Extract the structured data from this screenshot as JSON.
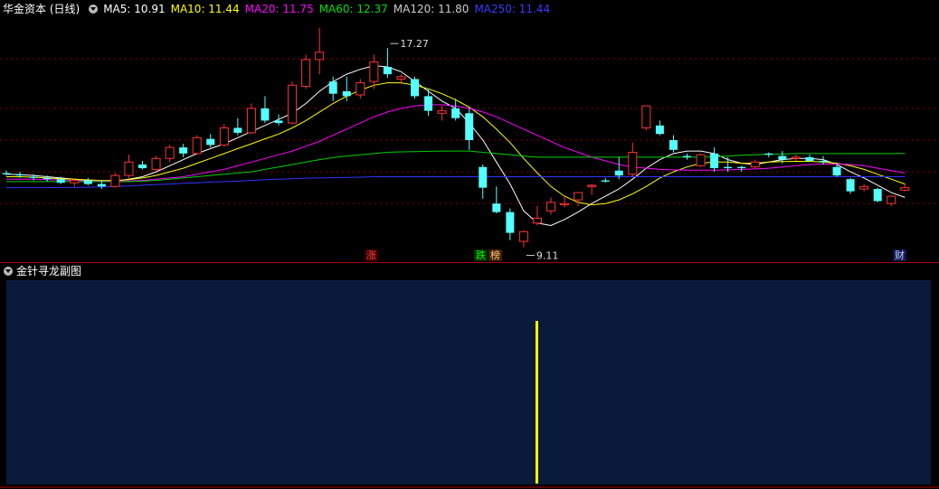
{
  "header": {
    "stock_name": "华金资本 (日线)",
    "ma": [
      {
        "label": "MA5: 10.91",
        "color": "#ffffff"
      },
      {
        "label": "MA10: 11.44",
        "color": "#ffff00"
      },
      {
        "label": "MA20: 11.75",
        "color": "#ff00ff"
      },
      {
        "label": "MA60: 12.37",
        "color": "#00e000"
      },
      {
        "label": "MA120: 11.80",
        "color": "#cccccc"
      },
      {
        "label": "MA250: 11.44",
        "color": "#2222ff"
      }
    ]
  },
  "sub_header": {
    "title": "金针寻龙副图"
  },
  "tags": {
    "zhang": "涨",
    "die": "跌",
    "bang": "榜",
    "cai": "财"
  },
  "colors": {
    "up": "#ff3232",
    "down": "#54ffff",
    "subpanel_bg": "#0a1a3a",
    "grid": "#8b0000",
    "signal": "#ffff00"
  },
  "chart_data": [
    {
      "type": "candlestick",
      "title": "华金资本 (日线)",
      "ylim": [
        8.5,
        18.5
      ],
      "annotations": [
        {
          "label": "17.27",
          "value": 17.27,
          "candle_index": 28
        },
        {
          "label": "9.11",
          "value": 9.11,
          "candle_index": 38
        }
      ],
      "candles": [
        [
          12.15,
          12.25,
          12.05,
          12.1
        ],
        [
          12.1,
          12.2,
          11.95,
          12.05
        ],
        [
          12.0,
          12.1,
          11.85,
          11.95
        ],
        [
          11.95,
          12.05,
          11.8,
          11.9
        ],
        [
          11.9,
          12.0,
          11.7,
          11.75
        ],
        [
          11.75,
          11.9,
          11.6,
          11.85
        ],
        [
          11.85,
          11.95,
          11.65,
          11.7
        ],
        [
          11.7,
          11.85,
          11.5,
          11.6
        ],
        [
          11.6,
          12.15,
          11.55,
          12.05
        ],
        [
          12.05,
          12.9,
          11.95,
          12.6
        ],
        [
          12.5,
          12.65,
          12.3,
          12.35
        ],
        [
          12.3,
          12.85,
          12.2,
          12.75
        ],
        [
          12.75,
          13.3,
          12.6,
          13.2
        ],
        [
          13.2,
          13.35,
          12.8,
          12.95
        ],
        [
          12.95,
          13.7,
          12.9,
          13.6
        ],
        [
          13.55,
          13.75,
          13.2,
          13.3
        ],
        [
          13.3,
          14.15,
          13.25,
          14.0
        ],
        [
          14.0,
          14.4,
          13.7,
          13.8
        ],
        [
          13.8,
          15.0,
          13.75,
          14.8
        ],
        [
          14.8,
          15.3,
          14.2,
          14.3
        ],
        [
          14.3,
          14.55,
          14.1,
          14.2
        ],
        [
          14.2,
          15.9,
          14.15,
          15.75
        ],
        [
          15.7,
          17.0,
          15.6,
          16.8
        ],
        [
          16.8,
          18.1,
          16.2,
          17.1
        ],
        [
          15.9,
          16.1,
          15.1,
          15.4
        ],
        [
          15.5,
          16.1,
          15.1,
          15.3
        ],
        [
          15.35,
          16.0,
          15.2,
          15.85
        ],
        [
          15.9,
          17.0,
          15.6,
          16.7
        ],
        [
          16.5,
          17.27,
          16.05,
          16.2
        ],
        [
          16.0,
          16.2,
          15.8,
          16.1
        ],
        [
          16.0,
          16.1,
          15.2,
          15.3
        ],
        [
          15.3,
          15.6,
          14.5,
          14.7
        ],
        [
          14.6,
          14.9,
          14.3,
          14.7
        ],
        [
          14.8,
          15.2,
          14.3,
          14.4
        ],
        [
          14.6,
          14.8,
          13.1,
          13.5
        ],
        [
          12.4,
          12.5,
          11.1,
          11.55
        ],
        [
          10.9,
          11.6,
          10.5,
          10.55
        ],
        [
          10.55,
          10.7,
          9.4,
          9.7
        ],
        [
          9.35,
          9.8,
          9.11,
          9.75
        ],
        [
          10.1,
          10.8,
          10.0,
          10.3
        ],
        [
          10.6,
          11.15,
          10.45,
          10.95
        ],
        [
          10.85,
          11.2,
          10.75,
          10.9
        ],
        [
          11.05,
          11.35,
          10.8,
          11.35
        ],
        [
          11.6,
          11.7,
          11.25,
          11.65
        ],
        [
          11.85,
          11.95,
          11.75,
          11.8
        ],
        [
          12.25,
          12.8,
          11.9,
          12.05
        ],
        [
          12.1,
          13.4,
          12.0,
          13.0
        ],
        [
          14.0,
          14.8,
          13.9,
          14.9
        ],
        [
          14.1,
          14.3,
          13.7,
          13.75
        ],
        [
          13.5,
          13.7,
          13.0,
          13.1
        ],
        [
          12.85,
          12.95,
          12.7,
          12.8
        ],
        [
          12.45,
          12.95,
          12.4,
          12.9
        ],
        [
          12.95,
          13.2,
          12.2,
          12.35
        ],
        [
          12.4,
          12.8,
          12.2,
          12.35
        ],
        [
          12.4,
          12.45,
          12.2,
          12.35
        ],
        [
          12.4,
          12.7,
          12.35,
          12.6
        ],
        [
          12.95,
          13.0,
          12.8,
          12.9
        ],
        [
          12.85,
          13.05,
          12.55,
          12.7
        ],
        [
          12.75,
          12.9,
          12.65,
          12.8
        ],
        [
          12.8,
          12.9,
          12.6,
          12.65
        ],
        [
          12.65,
          12.85,
          12.5,
          12.6
        ],
        [
          12.4,
          12.5,
          12.0,
          12.05
        ],
        [
          11.9,
          11.95,
          11.3,
          11.4
        ],
        [
          11.5,
          11.7,
          11.4,
          11.6
        ],
        [
          11.5,
          11.55,
          10.95,
          11.0
        ],
        [
          10.9,
          11.25,
          10.8,
          11.2
        ],
        [
          11.45,
          11.7,
          11.4,
          11.55
        ]
      ],
      "ma_lines": {
        "MA5": [
          12.1,
          12.08,
          12.05,
          12.0,
          11.95,
          11.9,
          11.85,
          11.8,
          11.82,
          11.9,
          12.0,
          12.2,
          12.45,
          12.7,
          12.95,
          13.15,
          13.35,
          13.6,
          13.85,
          14.1,
          14.35,
          14.6,
          15.0,
          15.5,
          15.9,
          16.2,
          16.4,
          16.55,
          16.5,
          16.3,
          15.9,
          15.5,
          15.1,
          14.8,
          14.2,
          13.5,
          12.6,
          11.7,
          10.6,
          10.1,
          10.0,
          10.25,
          10.55,
          10.9,
          11.2,
          11.5,
          11.9,
          12.35,
          12.7,
          12.95,
          13.05,
          13.05,
          12.95,
          12.7,
          12.55,
          12.5,
          12.6,
          12.7,
          12.75,
          12.75,
          12.7,
          12.5,
          12.2,
          11.95,
          11.65,
          11.35,
          11.15
        ],
        "MA10": [
          12.0,
          12.0,
          11.98,
          11.95,
          11.92,
          11.9,
          11.87,
          11.85,
          11.85,
          11.88,
          11.95,
          12.05,
          12.2,
          12.35,
          12.55,
          12.75,
          12.95,
          13.15,
          13.35,
          13.55,
          13.75,
          14.0,
          14.3,
          14.65,
          15.0,
          15.3,
          15.55,
          15.75,
          15.85,
          15.85,
          15.75,
          15.6,
          15.4,
          15.15,
          14.85,
          14.45,
          13.95,
          13.4,
          12.75,
          12.15,
          11.6,
          11.2,
          10.95,
          10.85,
          10.9,
          11.05,
          11.3,
          11.6,
          11.95,
          12.2,
          12.4,
          12.55,
          12.6,
          12.6,
          12.55,
          12.55,
          12.6,
          12.62,
          12.63,
          12.63,
          12.6,
          12.55,
          12.45,
          12.3,
          12.1,
          11.9,
          11.7
        ],
        "MA20": [
          11.9,
          11.9,
          11.9,
          11.88,
          11.87,
          11.85,
          11.83,
          11.82,
          11.82,
          11.83,
          11.85,
          11.9,
          11.95,
          12.0,
          12.1,
          12.2,
          12.3,
          12.45,
          12.6,
          12.75,
          12.9,
          13.05,
          13.25,
          13.45,
          13.7,
          13.95,
          14.2,
          14.45,
          14.65,
          14.8,
          14.9,
          14.95,
          14.95,
          14.9,
          14.8,
          14.65,
          14.45,
          14.2,
          13.95,
          13.7,
          13.45,
          13.2,
          13.0,
          12.8,
          12.65,
          12.5,
          12.4,
          12.35,
          12.3,
          12.28,
          12.27,
          12.27,
          12.27,
          12.28,
          12.3,
          12.32,
          12.35,
          12.4,
          12.45,
          12.5,
          12.52,
          12.52,
          12.5,
          12.45,
          12.35,
          12.25,
          12.15
        ],
        "MA60": [
          11.8,
          11.8,
          11.8,
          11.8,
          11.8,
          11.8,
          11.8,
          11.8,
          11.8,
          11.8,
          11.82,
          11.85,
          11.9,
          11.95,
          12.0,
          12.05,
          12.1,
          12.15,
          12.2,
          12.3,
          12.4,
          12.5,
          12.6,
          12.7,
          12.78,
          12.85,
          12.9,
          12.95,
          13.0,
          13.02,
          13.03,
          13.04,
          13.05,
          13.05,
          13.05,
          13.0,
          12.95,
          12.9,
          12.85,
          12.8,
          12.8,
          12.8,
          12.8,
          12.8,
          12.8,
          12.8,
          12.8,
          12.8,
          12.8,
          12.8,
          12.8,
          12.8,
          12.82,
          12.85,
          12.88,
          12.9,
          12.92,
          12.93,
          12.95,
          12.95,
          12.95,
          12.95,
          12.95,
          12.95,
          12.95,
          12.95,
          12.95
        ],
        "MA250": [
          11.55,
          11.55,
          11.55,
          11.55,
          11.56,
          11.56,
          11.57,
          11.58,
          11.6,
          11.62,
          11.65,
          11.68,
          11.7,
          11.73,
          11.75,
          11.78,
          11.8,
          11.82,
          11.85,
          11.88,
          11.9,
          11.92,
          11.94,
          11.95,
          11.96,
          11.97,
          11.98,
          12.0,
          12.0,
          12.0,
          12.0,
          12.0,
          12.0,
          12.0,
          12.0,
          12.0,
          12.0,
          12.0,
          12.0,
          12.0,
          12.0,
          12.0,
          12.0,
          12.0,
          12.0,
          12.0,
          12.0,
          12.0,
          12.0,
          12.0,
          12.0,
          12.0,
          12.0,
          12.0,
          12.0,
          12.0,
          12.0,
          12.0,
          12.0,
          12.0,
          12.0,
          12.0,
          12.0,
          12.0,
          12.0,
          12.0,
          12.0
        ]
      }
    },
    {
      "type": "bar",
      "title": "金针寻龙副图",
      "signal_candle_index": 39,
      "value": 1
    }
  ]
}
